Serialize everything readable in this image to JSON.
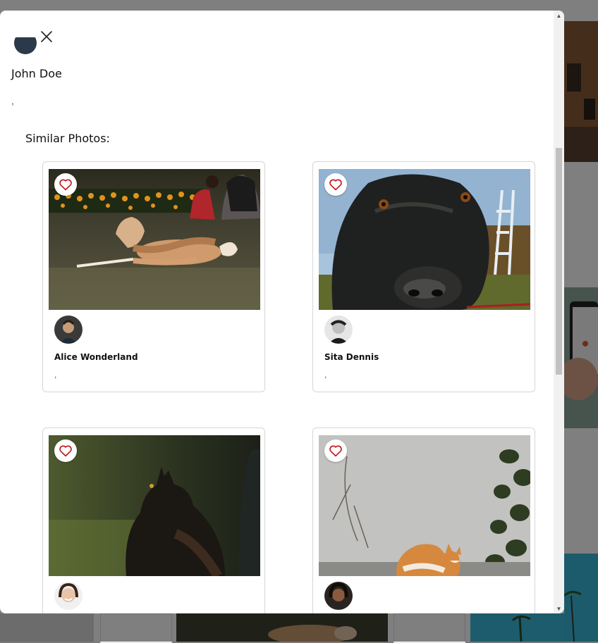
{
  "modal": {
    "close_icon": "close-icon",
    "author": {
      "name": "John Doe",
      "description": ","
    },
    "similar_heading": "Similar Photos:",
    "cards": [
      {
        "author_name": "Alice Wonderland",
        "description": ",",
        "image": "dog lying on grass",
        "like_icon": "heart-icon"
      },
      {
        "author_name": "Sita Dennis",
        "description": ",",
        "image": "black dog close-up",
        "like_icon": "heart-icon"
      },
      {
        "author_name": "",
        "description": "",
        "image": "fluffy black cat",
        "like_icon": "heart-icon"
      },
      {
        "author_name": "",
        "description": "",
        "image": "orange cat by wall",
        "like_icon": "heart-icon"
      }
    ]
  },
  "colors": {
    "heart": "#c0151b",
    "overlay": "#7a7a7a"
  }
}
